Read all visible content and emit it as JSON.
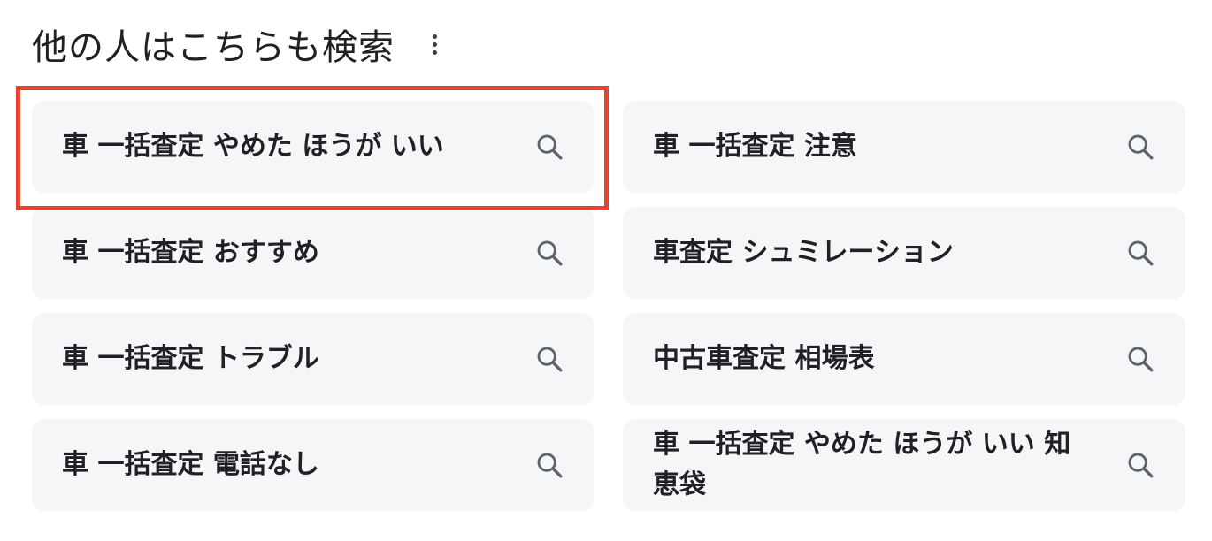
{
  "header": {
    "title": "他の人はこちらも検索",
    "more_icon": "more-vert-icon"
  },
  "suggestions": [
    {
      "label": "車 一括査定 やめた ほうが いい",
      "icon": "search-icon"
    },
    {
      "label": "車 一括査定 注意",
      "icon": "search-icon"
    },
    {
      "label": "車 一括査定 おすすめ",
      "icon": "search-icon"
    },
    {
      "label": "車査定 シュミレーション",
      "icon": "search-icon"
    },
    {
      "label": "車 一括査定 トラブル",
      "icon": "search-icon"
    },
    {
      "label": "中古車査定 相場表",
      "icon": "search-icon"
    },
    {
      "label": "車 一括査定 電話なし",
      "icon": "search-icon"
    },
    {
      "label": "車 一括査定 やめた ほうが いい 知恵袋",
      "icon": "search-icon"
    }
  ],
  "highlight": {
    "color": "#e8412c",
    "target": "suggestion-1"
  }
}
